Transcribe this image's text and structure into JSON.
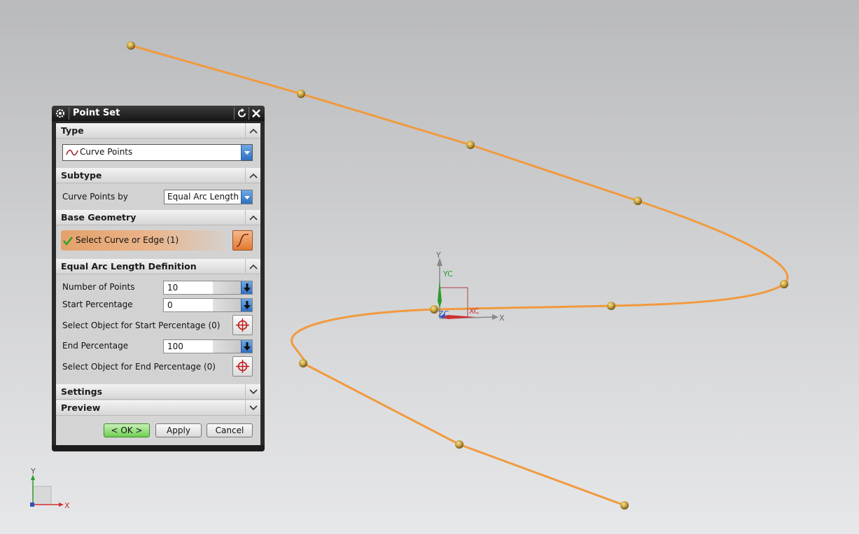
{
  "dialog": {
    "title": "Point Set",
    "sections": {
      "type": {
        "header": "Type",
        "selected": "Curve Points"
      },
      "subtype": {
        "header": "Subtype",
        "label": "Curve Points by",
        "selected": "Equal Arc Length"
      },
      "base_geometry": {
        "header": "Base Geometry",
        "select_label": "Select Curve or Edge (1)"
      },
      "equal_arc": {
        "header": "Equal Arc Length Definition",
        "number_of_points_label": "Number of Points",
        "number_of_points_value": "10",
        "start_percentage_label": "Start Percentage",
        "start_percentage_value": "0",
        "select_start_label": "Select Object for Start Percentage (0)",
        "end_percentage_label": "End Percentage",
        "end_percentage_value": "100",
        "select_end_label": "Select Object for End Percentage (0)"
      },
      "settings": {
        "header": "Settings"
      },
      "preview": {
        "header": "Preview"
      }
    },
    "buttons": {
      "ok": "< OK >",
      "apply": "Apply",
      "cancel": "Cancel"
    }
  },
  "viewport": {
    "wcs_labels": {
      "y": "Y",
      "yc": "YC",
      "xc": "XC",
      "zc": "ZC",
      "x": "X"
    },
    "triad_labels": {
      "y": "Y",
      "x": "X"
    },
    "colors": {
      "curve": "#f19a3e",
      "point": "#c8a03a",
      "background_top": "#b9babc",
      "background_bottom": "#e6e7e9"
    }
  }
}
